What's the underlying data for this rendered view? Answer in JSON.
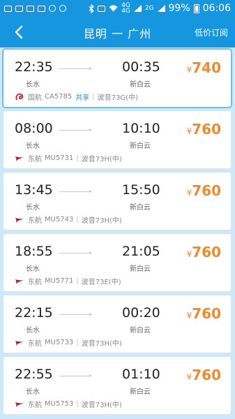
{
  "status_bar": {
    "battery": "99%",
    "time": "06:06",
    "network_4g_top": "4G",
    "network_4g_bottom": "4G",
    "network_2g": "2G"
  },
  "nav": {
    "title": "昆明 一 广州",
    "action": "低价订阅"
  },
  "flights": [
    {
      "dep_time": "22:35",
      "dep_airport": "长水",
      "arr_time": "00:35",
      "arr_airport": "新白云",
      "currency": "¥",
      "price": "740",
      "airline": "国航",
      "flight_no": "CA5785",
      "share": "共享",
      "aircraft": "波音73G(中)"
    },
    {
      "dep_time": "08:00",
      "dep_airport": "长水",
      "arr_time": "10:10",
      "arr_airport": "新白云",
      "currency": "¥",
      "price": "760",
      "airline": "东航",
      "flight_no": "MU5731",
      "share": "",
      "aircraft": "波音73H(中)"
    },
    {
      "dep_time": "13:45",
      "dep_airport": "长水",
      "arr_time": "15:50",
      "arr_airport": "新白云",
      "currency": "¥",
      "price": "760",
      "airline": "东航",
      "flight_no": "MU5743",
      "share": "",
      "aircraft": "波音73H(中)"
    },
    {
      "dep_time": "18:55",
      "dep_airport": "长水",
      "arr_time": "21:05",
      "arr_airport": "新白云",
      "currency": "¥",
      "price": "760",
      "airline": "东航",
      "flight_no": "MU5771",
      "share": "",
      "aircraft": "波音73E(中)"
    },
    {
      "dep_time": "22:15",
      "dep_airport": "长水",
      "arr_time": "00:20",
      "arr_airport": "新白云",
      "currency": "¥",
      "price": "760",
      "airline": "东航",
      "flight_no": "MU5733",
      "share": "",
      "aircraft": "波音73H(中)"
    },
    {
      "dep_time": "22:55",
      "dep_airport": "长水",
      "arr_time": "01:10",
      "arr_airport": "新白云",
      "currency": "¥",
      "price": "760",
      "airline": "东航",
      "flight_no": "MU5753",
      "share": "",
      "aircraft": "波音73H(中)"
    }
  ],
  "colors": {
    "brand_blue": "#1796e0",
    "price_orange": "#f08a2a",
    "air_china_red": "#e60012",
    "china_eastern_red": "#c8102e"
  },
  "icons": {
    "back": "chevron-left-icon",
    "air_china_logo": "air-china-logo-icon",
    "china_eastern_logo": "china-eastern-logo-icon"
  }
}
